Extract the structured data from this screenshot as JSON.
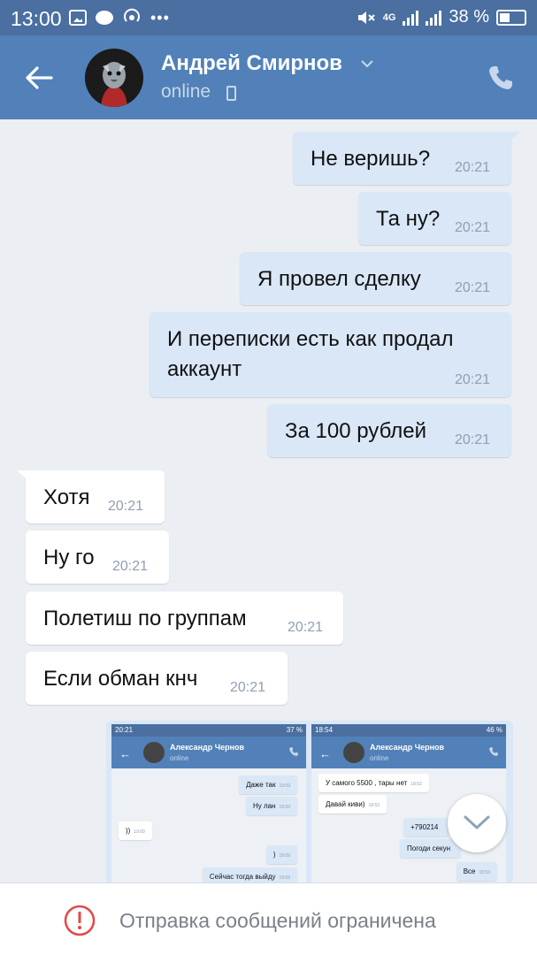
{
  "status_bar": {
    "time": "13:00",
    "network": "4G",
    "battery": "38 %",
    "icons": [
      "gallery-icon",
      "chat-icon",
      "hotspot-icon",
      "more-dots-icon",
      "mute-icon",
      "signal-icon",
      "battery-icon"
    ]
  },
  "header": {
    "name": "Андрей Смирнов",
    "status": "online",
    "icons": [
      "back-arrow-icon",
      "chevron-down-icon",
      "mobile-icon",
      "phone-icon"
    ]
  },
  "messages": [
    {
      "dir": "out",
      "text": "Не веришь?",
      "time": "20:21"
    },
    {
      "dir": "out",
      "text": "Та ну?",
      "time": "20:21"
    },
    {
      "dir": "out",
      "text": "Я провел сделку",
      "time": "20:21"
    },
    {
      "dir": "out",
      "text_line1": "И переписки есть как продал",
      "text_line2": "аккаунт",
      "time": "20:21"
    },
    {
      "dir": "out",
      "text": "За 100 рублей",
      "time": "20:21"
    },
    {
      "dir": "in",
      "text": "Хотя",
      "time": "20:21"
    },
    {
      "dir": "in",
      "text": "Ну го",
      "time": "20:21"
    },
    {
      "dir": "in",
      "text": "Полетиш по группам",
      "time": "20:21"
    },
    {
      "dir": "in",
      "text": "Если обман кнч",
      "time": "20:21"
    }
  ],
  "attachment": {
    "left": {
      "status_time": "20:21",
      "status_right": "37 %",
      "name": "Александр Чернов",
      "status": "online",
      "messages": [
        {
          "text": "Даже так",
          "time": "19:09"
        },
        {
          "text": "Ну лан",
          "time": "19:09"
        },
        {
          "text": "))",
          "time": "19:09"
        },
        {
          "text": ")",
          "time": "19:09"
        },
        {
          "text": "Сейчас тогда выйду",
          "time": "19:09"
        }
      ]
    },
    "right": {
      "status_time": "18:54",
      "status_right": "46 %",
      "name": "Александр Чернов",
      "status": "online",
      "messages": [
        {
          "text": "У самого 5500 , тары нет",
          "time": "18:52"
        },
        {
          "text": "Давай киви)",
          "time": "18:53"
        },
        {
          "text": "+790214",
          "time": ""
        },
        {
          "text": "Погоди секун",
          "time": ""
        },
        {
          "text": "Все",
          "time": "18:53"
        }
      ]
    }
  },
  "footer": {
    "text": "Отправка сообщений ограничена",
    "icon": "warning-icon"
  },
  "colors": {
    "header": "#5181b8",
    "status_bar": "#4a6fa0",
    "background": "#ebeef3",
    "outgoing_bubble": "#d9e7f7",
    "incoming_bubble": "#ffffff",
    "warning": "#e64646"
  }
}
